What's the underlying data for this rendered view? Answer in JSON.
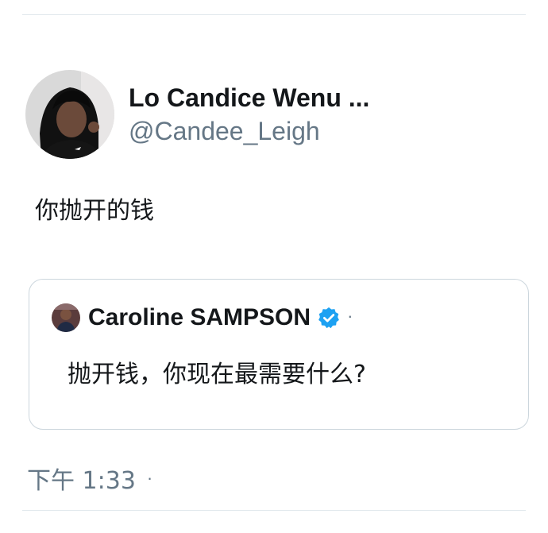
{
  "tweet": {
    "author": {
      "display_name": "Lo Candice Wenu ...",
      "handle": "@Candee_Leigh",
      "avatar_icon": "avatar-photo"
    },
    "text": "你抛开的钱",
    "quoted_tweet": {
      "author_name": "Caroline SAMPSON",
      "verified": true,
      "separator": "·",
      "text": "抛开钱，你现在最需要什么?"
    },
    "timestamp": "下午 1:33",
    "meta_separator": "·"
  },
  "colors": {
    "text_primary": "#14171a",
    "text_secondary": "#657786",
    "verified_badge": "#1da1f2",
    "border": "#ccd6dd"
  }
}
